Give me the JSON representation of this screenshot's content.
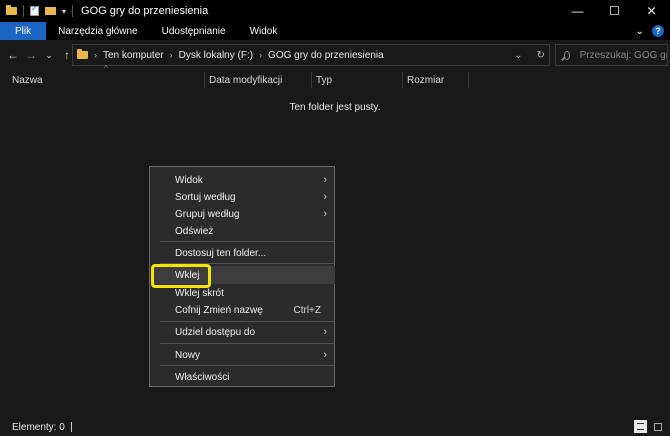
{
  "window": {
    "title": "GOG gry do przeniesienia",
    "quick_access_dropdown": "▾",
    "controls": {
      "minimize": "—",
      "maximize": "☐",
      "close": "✕"
    }
  },
  "ribbon": {
    "tabs": [
      "Plik",
      "Narzędzia główne",
      "Udostępnianie",
      "Widok"
    ],
    "expand_glyph": "⌄",
    "help_glyph": "?"
  },
  "nav": {
    "back": "←",
    "forward": "→",
    "recent": "⌄",
    "up": "↑",
    "breadcrumb": [
      "Ten komputer",
      "Dysk lokalny (F:)",
      "GOG gry do przeniesienia"
    ],
    "crumb_separator": "›",
    "history_dropdown": "⌄",
    "refresh": "↻",
    "search_placeholder": "Przeszukaj: GOG gry do przeniesienia"
  },
  "columns": [
    "Nazwa",
    "Data modyfikacji",
    "Typ",
    "Rozmiar"
  ],
  "sort_caret": "^",
  "empty_message": "Ten folder jest pusty.",
  "context_menu": {
    "items": [
      {
        "label": "Widok",
        "arrow": "›"
      },
      {
        "label": "Sortuj według",
        "arrow": "›"
      },
      {
        "label": "Grupuj według",
        "arrow": "›"
      },
      {
        "label": "Odśwież"
      },
      {
        "label": "Dostosuj ten folder..."
      },
      {
        "label": "Wklej",
        "highlighted": true
      },
      {
        "label": "Wklej skrót"
      },
      {
        "label": "Cofnij Zmień nazwę",
        "shortcut": "Ctrl+Z"
      },
      {
        "label": "Udziel dostępu do",
        "arrow": "›"
      },
      {
        "label": "Nowy",
        "arrow": "›"
      },
      {
        "label": "Właściwości"
      }
    ]
  },
  "status_bar": {
    "text": "Elementy: 0"
  },
  "colors": {
    "accent": "#1a64c2",
    "callout": "#f2e600",
    "background": "#191919"
  },
  "icons": [
    "folder-icon",
    "properties-icon",
    "new-folder-icon",
    "search-icon",
    "details-view-icon",
    "tiles-view-icon"
  ]
}
